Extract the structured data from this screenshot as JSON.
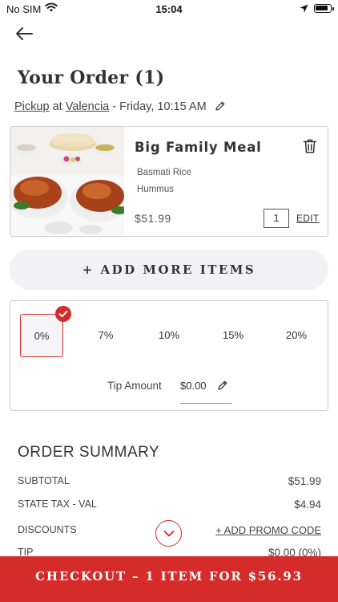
{
  "status_bar": {
    "carrier": "No SIM",
    "time": "15:04"
  },
  "header": {
    "title": "Your Order (1)"
  },
  "pickup": {
    "method": "Pickup",
    "at": "at",
    "location": "Valencia",
    "datetime": " - Friday, 10:15 AM"
  },
  "order_item": {
    "name": "Big Family Meal",
    "options": [
      "Basmati Rice",
      "Hummus"
    ],
    "price": "$51.99",
    "quantity": "1",
    "edit_label": "EDIT"
  },
  "add_more_label": "+ ADD MORE ITEMS",
  "tip": {
    "options": [
      "0%",
      "7%",
      "10%",
      "15%",
      "20%"
    ],
    "selected": "0%",
    "amount_label": "Tip Amount",
    "amount_value": "$0.00"
  },
  "summary": {
    "title": "ORDER SUMMARY",
    "subtotal_label": "SUBTOTAL",
    "subtotal_value": "$51.99",
    "tax_label": "STATE TAX - VAL",
    "tax_value": "$4.94",
    "discounts_label": "DISCOUNTS",
    "promo_label": "+ ADD PROMO CODE",
    "tip_label": "TIP",
    "tip_value": "$0.00 (0%)"
  },
  "checkout_label": "CHECKOUT – 1 ITEM FOR $56.93",
  "colors": {
    "accent": "#d52b2b",
    "text": "#333333",
    "border": "#cfcfcf",
    "pill_bg": "#f2f2f5"
  }
}
